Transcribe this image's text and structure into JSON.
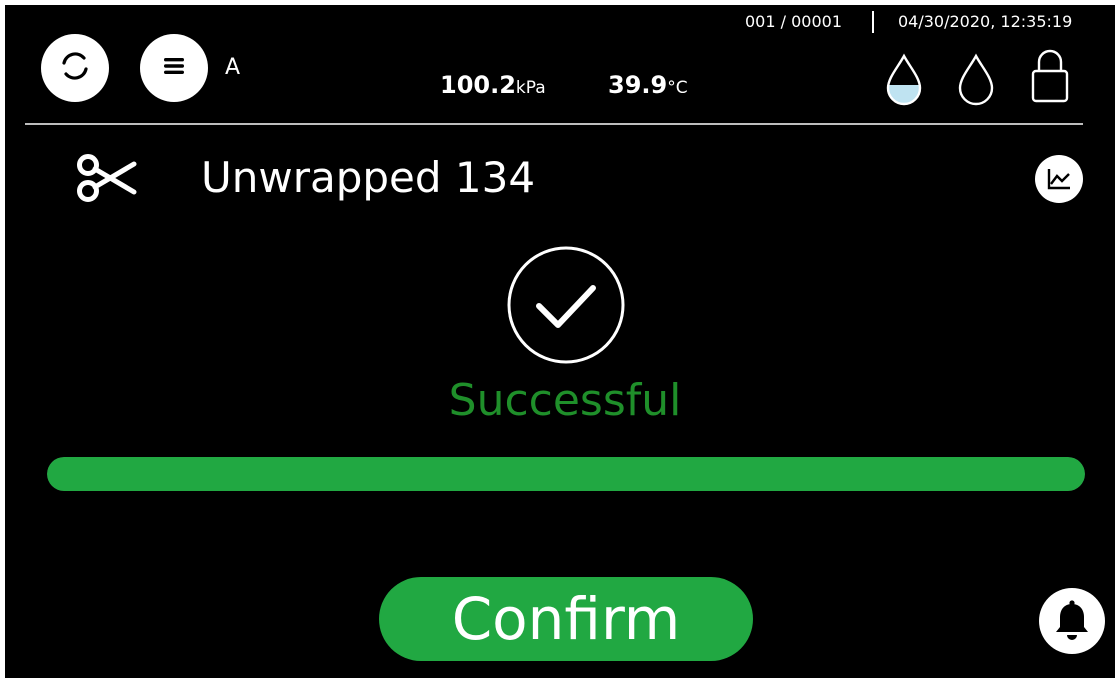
{
  "header": {
    "operator": "A",
    "cycle_counter": "001 / 00001",
    "datetime": "04/30/2020, 12:35:19",
    "pressure_value": "100.2",
    "pressure_unit": "kPa",
    "temperature_value": "39.9",
    "temperature_unit": "°C",
    "icons": [
      "refresh-icon",
      "menu-icon",
      "water-tank-clean-icon",
      "water-tank-waste-icon",
      "door-lock-icon"
    ]
  },
  "cycle": {
    "name": "Unwrapped 134",
    "icon": "scissors-icon",
    "chart_icon": "chart-icon"
  },
  "result": {
    "label": "Successful",
    "icon": "checkmark-icon",
    "progress": 1.0
  },
  "actions": {
    "confirm_label": "Confirm",
    "alarm_icon": "bell-icon"
  },
  "colors": {
    "background": "#000000",
    "foreground": "#ffffff",
    "success_text": "#1f8f2a",
    "progress_fill": "#21a842",
    "confirm_button": "#21a842",
    "water_level": "#bfe3f1",
    "divider": "#bdbdbd"
  }
}
